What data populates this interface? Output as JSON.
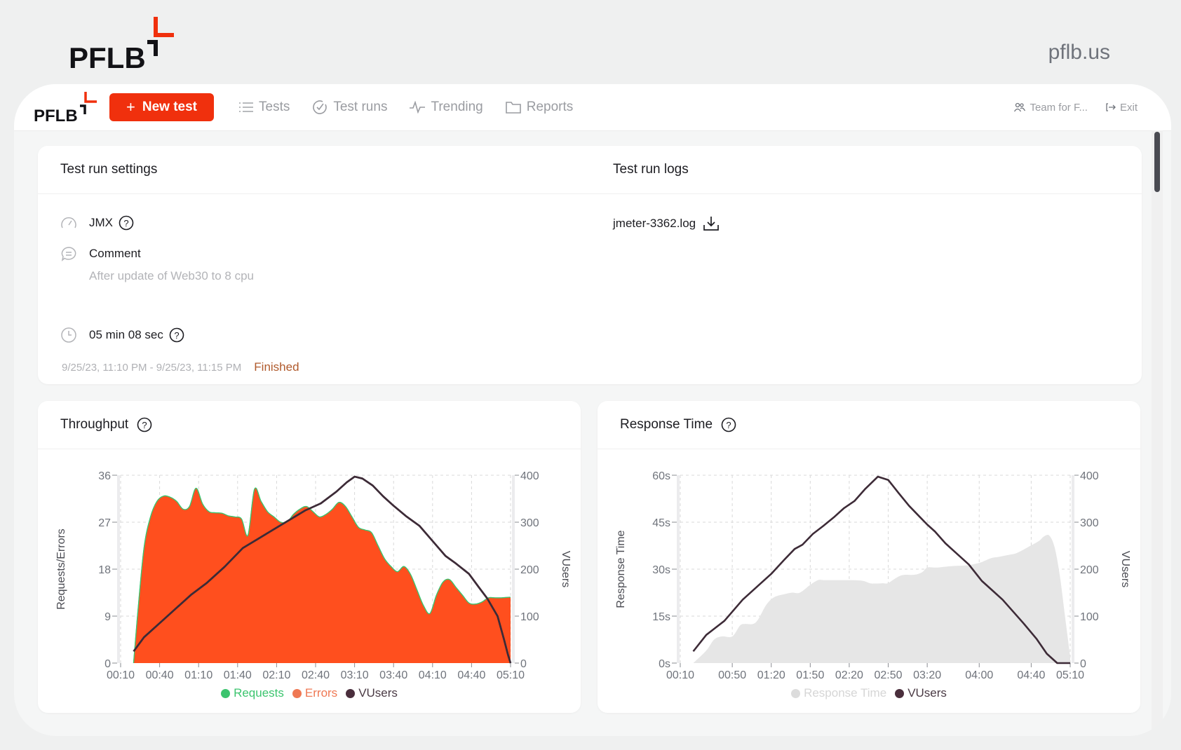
{
  "brand": {
    "logo_text": "PFLB",
    "site": "pflb.us",
    "accent": "#f0300d"
  },
  "topbar": {
    "logo_text": "PFLB",
    "new_test_label": "New test",
    "nav": [
      {
        "label": "Tests",
        "icon": "list-icon"
      },
      {
        "label": "Test runs",
        "icon": "check-circle-icon"
      },
      {
        "label": "Trending",
        "icon": "pulse-icon"
      },
      {
        "label": "Reports",
        "icon": "folder-icon"
      }
    ],
    "team_label": "Team for F...",
    "exit_label": "Exit"
  },
  "settings": {
    "title": "Test run settings",
    "type_label": "JMX",
    "comment_label": "Comment",
    "comment_text": "After update of Web30 to 8 cpu",
    "duration": "05 min 08 sec",
    "date_range": "9/25/23, 11:10 PM - 9/25/23, 11:15 PM",
    "status": "Finished"
  },
  "logs": {
    "title": "Test run logs",
    "file": "jmeter-3362.log"
  },
  "chart_data": [
    {
      "type": "area",
      "title": "Throughput",
      "ylabel": "Requests/Errors",
      "y2label": "VUsers",
      "ylim": [
        0,
        36
      ],
      "y2lim": [
        0,
        400
      ],
      "yticks": [
        "0",
        "9",
        "18",
        "27",
        "36"
      ],
      "y2ticks": [
        "0",
        "100",
        "200",
        "300",
        "400"
      ],
      "xlim": [
        10,
        310
      ],
      "xticks": [
        "00:10",
        "00:40",
        "01:10",
        "01:40",
        "02:10",
        "02:40",
        "03:10",
        "03:40",
        "04:10",
        "04:40",
        "05:10"
      ],
      "xtick_seconds": [
        10,
        40,
        70,
        100,
        130,
        160,
        190,
        220,
        250,
        280,
        310
      ],
      "grid": true,
      "legend_position": "bottom",
      "series": [
        {
          "name": "Requests",
          "color": "#3cc46e",
          "kind": "area-outline",
          "x": [
            20,
            23,
            28,
            33,
            38,
            43,
            48,
            53,
            58,
            63,
            68,
            73,
            78,
            83,
            88,
            93,
            98,
            103,
            108,
            113,
            118,
            123,
            128,
            133,
            138,
            143,
            148,
            153,
            158,
            163,
            168,
            173,
            178,
            183,
            188,
            193,
            198,
            203,
            208,
            213,
            218,
            223,
            228,
            233,
            238,
            243,
            248,
            253,
            258,
            263,
            268,
            273,
            278,
            283,
            288,
            293,
            298,
            303,
            308,
            310
          ],
          "values": [
            0,
            9,
            22,
            28,
            31,
            32,
            31.8,
            31,
            29.5,
            30,
            33.5,
            30.5,
            29,
            28.8,
            28.7,
            28.2,
            28,
            27.6,
            24.5,
            33.3,
            31,
            29,
            28,
            27,
            27,
            28.5,
            29.5,
            30,
            29,
            28,
            28.5,
            29.5,
            30.8,
            30,
            28,
            26,
            25.5,
            25,
            22.5,
            20,
            18.5,
            17.5,
            18.5,
            17,
            14,
            11,
            9.5,
            13,
            15.5,
            16,
            14.5,
            13,
            11.5,
            11.3,
            11.7,
            12.5,
            12.5,
            12.5,
            12.6,
            12.6
          ]
        },
        {
          "name": "Errors",
          "color": "#ff4f1e",
          "kind": "area",
          "x": [
            20,
            23,
            28,
            33,
            38,
            43,
            48,
            53,
            58,
            63,
            68,
            73,
            78,
            83,
            88,
            93,
            98,
            103,
            108,
            113,
            118,
            123,
            128,
            133,
            138,
            143,
            148,
            153,
            158,
            163,
            168,
            173,
            178,
            183,
            188,
            193,
            198,
            203,
            208,
            213,
            218,
            223,
            228,
            233,
            238,
            243,
            248,
            253,
            258,
            263,
            268,
            273,
            278,
            283,
            288,
            293,
            298,
            303,
            308,
            310
          ],
          "values": [
            0,
            9,
            22,
            28,
            31,
            32,
            31.8,
            31,
            29.5,
            30,
            33.5,
            30.5,
            29,
            28.8,
            28.7,
            28.2,
            28,
            27.6,
            24.5,
            33.3,
            31,
            29,
            28,
            27,
            27,
            28.5,
            29.5,
            30,
            29,
            28,
            28.5,
            29.5,
            30.8,
            30,
            28,
            26,
            25.5,
            25,
            22.5,
            20,
            18.5,
            17.5,
            18.5,
            17,
            14,
            11,
            9.5,
            13,
            15.5,
            16,
            14.5,
            13,
            11.5,
            11.3,
            11.7,
            12.5,
            12.5,
            12.5,
            12.6,
            12.6
          ]
        },
        {
          "name": "VUsers",
          "color": "#3d2b37",
          "kind": "line",
          "axis": "y2",
          "x": [
            20,
            28,
            40,
            52,
            64,
            76,
            90,
            104,
            116,
            128,
            140,
            152,
            164,
            176,
            184,
            190,
            196,
            204,
            212,
            220,
            230,
            240,
            250,
            260,
            268,
            278,
            286,
            292,
            300,
            305,
            308,
            310
          ],
          "values": [
            25,
            55,
            85,
            115,
            145,
            170,
            205,
            245,
            265,
            285,
            305,
            325,
            340,
            365,
            385,
            397,
            393,
            378,
            355,
            335,
            312,
            292,
            260,
            228,
            212,
            190,
            160,
            138,
            100,
            50,
            18,
            0
          ]
        }
      ]
    },
    {
      "type": "area",
      "title": "Response Time",
      "ylabel": "Response Time",
      "y2label": "VUsers",
      "ylim": [
        0,
        60
      ],
      "y2lim": [
        0,
        400
      ],
      "yticks": [
        "0s",
        "15s",
        "30s",
        "45s",
        "60s"
      ],
      "y2ticks": [
        "0",
        "100",
        "200",
        "300",
        "400"
      ],
      "xlim": [
        10,
        310
      ],
      "xticks": [
        "00:10",
        "00:50",
        "01:20",
        "01:50",
        "02:20",
        "02:50",
        "03:20",
        "04:00",
        "04:40",
        "05:10"
      ],
      "xtick_seconds": [
        10,
        50,
        80,
        110,
        140,
        170,
        200,
        240,
        280,
        310
      ],
      "grid": true,
      "legend_position": "bottom",
      "series": [
        {
          "name": "Response Time",
          "color": "#e6e6e6",
          "kind": "area",
          "x": [
            20,
            30,
            36,
            42,
            50,
            56,
            60,
            66,
            70,
            76,
            82,
            90,
            96,
            102,
            110,
            116,
            120,
            124,
            130,
            140,
            150,
            156,
            160,
            166,
            170,
            180,
            190,
            196,
            200,
            206,
            210,
            220,
            230,
            240,
            246,
            250,
            256,
            262,
            268,
            274,
            280,
            286,
            290,
            294,
            298,
            302,
            306,
            310
          ],
          "values": [
            0,
            4,
            7.5,
            8.5,
            8.5,
            12,
            12.5,
            12.5,
            14,
            18.5,
            21,
            22,
            22.5,
            22.5,
            25,
            26.5,
            26.5,
            26.5,
            26.5,
            26.5,
            26.3,
            25.5,
            25.4,
            25.5,
            25.6,
            28,
            28.2,
            29,
            30.5,
            30.5,
            30.6,
            31,
            31.2,
            32,
            33,
            33.6,
            34,
            34.5,
            35,
            36.2,
            37.6,
            39,
            40.5,
            40.7,
            37,
            28,
            15,
            2
          ]
        },
        {
          "name": "VUsers",
          "color": "#3d2b37",
          "kind": "line",
          "axis": "y2",
          "x": [
            20,
            30,
            44,
            58,
            70,
            80,
            90,
            98,
            104,
            112,
            120,
            128,
            136,
            144,
            152,
            162,
            170,
            178,
            186,
            194,
            200,
            206,
            214,
            222,
            232,
            242,
            250,
            258,
            266,
            274,
            284,
            292,
            300,
            304,
            306,
            310
          ],
          "values": [
            25,
            60,
            90,
            135,
            165,
            190,
            220,
            243,
            252,
            275,
            292,
            310,
            330,
            345,
            370,
            397,
            390,
            362,
            335,
            312,
            295,
            280,
            255,
            235,
            210,
            175,
            155,
            135,
            110,
            85,
            52,
            20,
            0,
            0,
            0,
            0
          ]
        }
      ]
    }
  ]
}
